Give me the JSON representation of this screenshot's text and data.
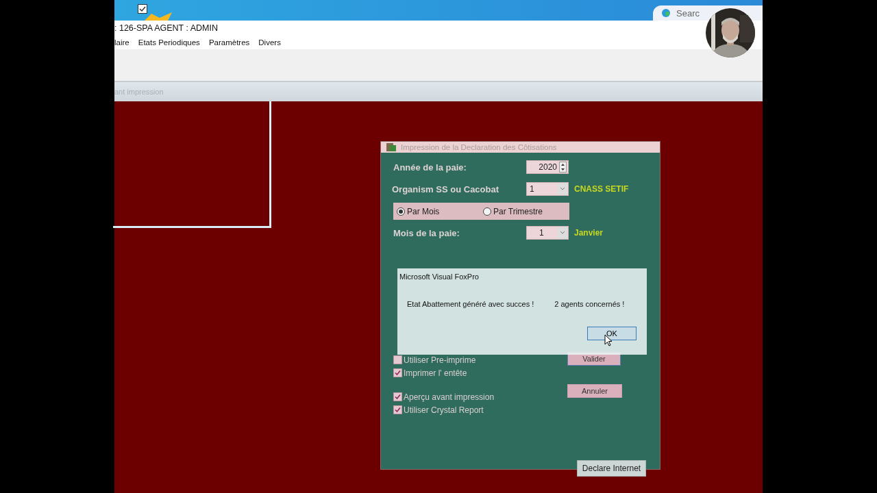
{
  "search": {
    "placeholder": "Searc"
  },
  "app": {
    "title": ": 126-SPA AGENT : ADMIN",
    "menu": [
      "laire",
      "Etats Periodiques",
      "Paramètres",
      "Divers"
    ],
    "status_text": "ant impression"
  },
  "dialog": {
    "title": "Impression de la Declaration des Côtisations",
    "year": {
      "label": "Année de la paie:",
      "value": "2020"
    },
    "organism": {
      "label": "Organism SS ou Cacobat",
      "value": "1",
      "note": "CNASS SETIF"
    },
    "period_options": [
      {
        "label": "Par  Mois",
        "selected": true
      },
      {
        "label": "Par Trimestre",
        "selected": false
      }
    ],
    "month": {
      "label": "Mois de la paie:",
      "value": "1",
      "note": "Janvier"
    },
    "options": [
      {
        "label": "Utiliser Pre-imprime",
        "checked": false
      },
      {
        "label": "Imprimer l' entête",
        "checked": true
      },
      {
        "label": "Aperçu avant impression",
        "checked": true
      },
      {
        "label": "Utiliser Crystal Report",
        "checked": true
      }
    ],
    "buttons": [
      "Valider",
      "Annuler"
    ],
    "declare_button": "Declare Internet"
  },
  "message_box": {
    "title": "Microsoft Visual FoxPro",
    "message": "Etat Abattement généré avec succes !",
    "detail": "2 agents concernés !",
    "button": "OK"
  }
}
